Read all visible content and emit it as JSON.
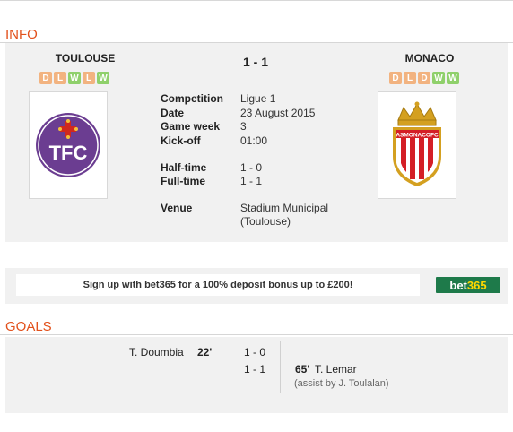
{
  "info": {
    "section_title": "INFO",
    "home": {
      "name": "TOULOUSE",
      "form": [
        "D",
        "L",
        "W",
        "L",
        "W"
      ],
      "crest_text": "TFC"
    },
    "away": {
      "name": "MONACO",
      "form": [
        "D",
        "L",
        "D",
        "W",
        "W"
      ],
      "crest_text": "ASMONACOFC"
    },
    "score": "1 - 1",
    "details": [
      {
        "label": "Competition",
        "value": "Ligue 1"
      },
      {
        "label": "Date",
        "value": "23 August 2015"
      },
      {
        "label": "Game week",
        "value": "3"
      },
      {
        "label": "Kick-off",
        "value": "01:00"
      },
      {
        "label": "Half-time",
        "value": "1 - 0"
      },
      {
        "label": "Full-time",
        "value": "1 - 1"
      },
      {
        "label": "Venue",
        "value": "Stadium Municipal"
      }
    ],
    "venue_line2": "(Toulouse)"
  },
  "ad": {
    "text": "Sign up with bet365 for a 100% deposit bonus up to £200!",
    "logo_prefix": "bet",
    "logo_suffix": "365"
  },
  "goals": {
    "section_title": "GOALS",
    "home_goal": {
      "player": "T. Doumbia",
      "minute": "22'"
    },
    "score_1": "1 - 0",
    "score_2": "1 - 1",
    "away_goal": {
      "minute": "65'",
      "player": "T. Lemar",
      "assist": "(assist by J. Toulalan)"
    }
  },
  "colors": {
    "accent": "#e2511c",
    "panel": "#f1f1f1",
    "win": "#8fd06b",
    "loss_draw": "#f2b380"
  }
}
